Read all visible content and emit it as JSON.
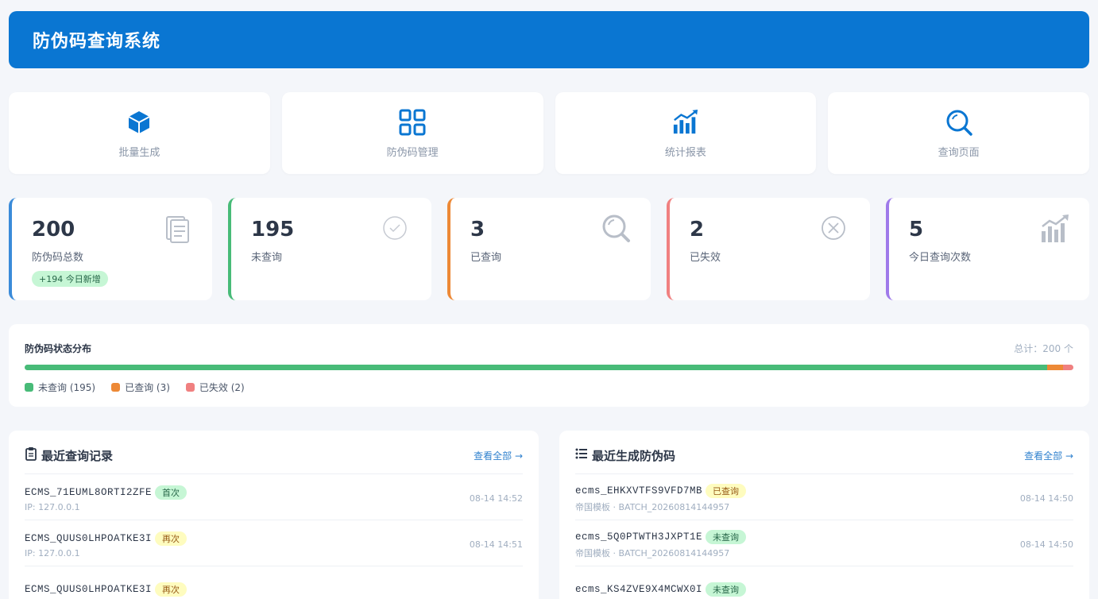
{
  "app": {
    "title": "防伪码查询系统"
  },
  "nav": [
    {
      "label": "批量生成",
      "icon": "box-icon"
    },
    {
      "label": "防伪码管理",
      "icon": "grid-icon"
    },
    {
      "label": "统计报表",
      "icon": "bar-chart-icon"
    },
    {
      "label": "查询页面",
      "icon": "search-icon"
    }
  ],
  "stats": [
    {
      "value": "200",
      "label": "防伪码总数",
      "badge": "+194 今日新增",
      "color": "#3a8bd9",
      "icon": "document-icon"
    },
    {
      "value": "195",
      "label": "未查询",
      "color": "#48bb78",
      "icon": "check-circle-icon"
    },
    {
      "value": "3",
      "label": "已查询",
      "color": "#ed8936",
      "icon": "search-icon"
    },
    {
      "value": "2",
      "label": "已失效",
      "color": "#f08080",
      "icon": "x-circle-icon"
    },
    {
      "value": "5",
      "label": "今日查询次数",
      "color": "#9f7aea",
      "icon": "chart-icon"
    }
  ],
  "distribution": {
    "title": "防伪码状态分布",
    "total": "总计：200 个",
    "segments": [
      {
        "label": "未查询 (195)",
        "value": 195,
        "color": "#48bb78"
      },
      {
        "label": "已查询 (3)",
        "value": 3,
        "color": "#ed8936"
      },
      {
        "label": "已失效 (2)",
        "value": 2,
        "color": "#f08080"
      }
    ]
  },
  "recent_queries": {
    "title": "最近查询记录",
    "link": "查看全部 →",
    "items": [
      {
        "code": "ECMS_71EUML8ORTI2ZFE",
        "tag": "首次",
        "tag_color": "green",
        "sub": "IP: 127.0.0.1",
        "time": "08-14 14:52"
      },
      {
        "code": "ECMS_QUUS0LHPOATKE3I",
        "tag": "再次",
        "tag_color": "yellow",
        "sub": "IP: 127.0.0.1",
        "time": "08-14 14:51"
      },
      {
        "code": "ECMS_QUUS0LHPOATKE3I",
        "tag": "再次",
        "tag_color": "yellow",
        "sub": "",
        "time": ""
      }
    ]
  },
  "recent_codes": {
    "title": "最近生成防伪码",
    "link": "查看全部 →",
    "items": [
      {
        "code": "ecms_EHKXVTFS9VFD7MB",
        "tag": "已查询",
        "tag_color": "yellow",
        "sub": "帝国模板 · BATCH_20260814144957",
        "time": "08-14 14:50"
      },
      {
        "code": "ecms_5Q0PTWTH3JXPT1E",
        "tag": "未查询",
        "tag_color": "green",
        "sub": "帝国模板 · BATCH_20260814144957",
        "time": "08-14 14:50"
      },
      {
        "code": "ecms_KS4ZVE9X4MCWX0I",
        "tag": "未查询",
        "tag_color": "green",
        "sub": "",
        "time": ""
      }
    ]
  }
}
